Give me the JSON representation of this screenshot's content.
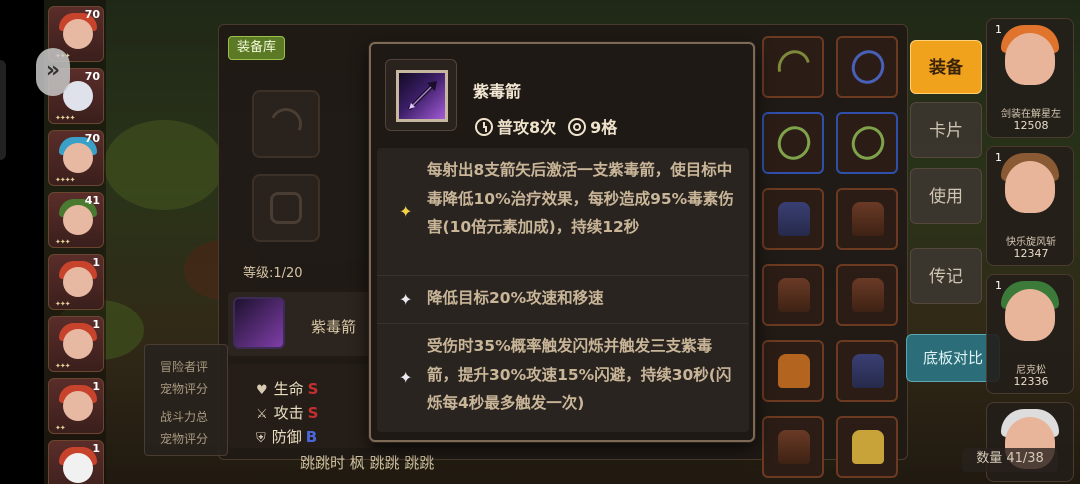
{
  "tooltip": {
    "title": "紫毒箭",
    "trigger": "普攻8次",
    "cells": "9格",
    "effects": [
      "每射出8支箭矢后激活一支紫毒箭，使目标中毒降低10%治疗效果，每秒造成95%毒素伤害(10倍元素加成)，持续12秒",
      "降低目标20%攻速和移速",
      "受伤时35%概率触发闪烁并触发三支紫毒箭，提升30%攻速15%闪避，持续30秒(闪烁每4秒最多触发一次)"
    ]
  },
  "library": {
    "tag": "装备库",
    "level": "等级:1/20",
    "selected_name": "紫毒箭",
    "stats": [
      {
        "label": "生命",
        "grade": "S"
      },
      {
        "label": "攻击",
        "grade": "S"
      },
      {
        "label": "防御",
        "grade": "B"
      }
    ],
    "info_lines": [
      "冒险者评",
      "宠物评分",
      "战斗力总",
      "宠物评分"
    ]
  },
  "side_buttons": {
    "equip": "装备",
    "card": "卡片",
    "use": "使用",
    "legend": "传记",
    "compare": "底板对比"
  },
  "heroes": [
    {
      "count": "1",
      "name": "剑装在解星左",
      "power": "12508"
    },
    {
      "count": "1",
      "name": "快乐旋风斩",
      "power": "12347"
    },
    {
      "count": "1",
      "name": "尼克松",
      "power": "12336"
    }
  ],
  "left_levels": [
    "70",
    "70",
    "70",
    "41",
    "1",
    "1",
    "1",
    "1"
  ],
  "footer": {
    "count_label": "数量",
    "count": "41/38",
    "bottom_text": "跳跳时 枫 跳跳 跳跳"
  },
  "colors": {
    "accent_orange": "#f0a21d",
    "compare_teal": "#2b6d78",
    "tooltip_bg": "#1f1915",
    "star_gold": "#f1d04a"
  }
}
